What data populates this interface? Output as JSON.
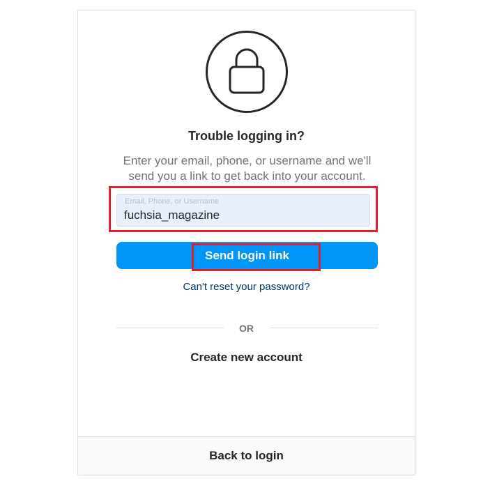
{
  "header": {
    "icon": "lock-icon",
    "title": "Trouble logging in?",
    "subtitle": "Enter your email, phone, or username and we'll send you a link to get back into your account."
  },
  "form": {
    "input_placeholder": "Email, Phone, or Username",
    "input_value": "fuchsia_magazine",
    "send_label": "Send login link",
    "reset_link": "Can't reset your password?"
  },
  "separator": {
    "or_label": "OR"
  },
  "actions": {
    "create_account": "Create new account",
    "back_to_login": "Back to login"
  },
  "colors": {
    "accent": "#0095f6",
    "highlight": "#e0202e",
    "input_bg": "#e8f0fe",
    "link": "#00376b"
  }
}
